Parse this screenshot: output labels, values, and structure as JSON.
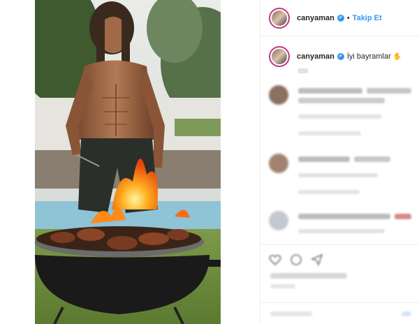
{
  "header": {
    "username": "canyaman",
    "verified_badge": "✔",
    "separator": "•",
    "follow_label": "Takip Et"
  },
  "caption": {
    "username": "canyaman",
    "verified_badge": "✔",
    "text": "İyi bayramlar",
    "emoji": "✋"
  },
  "colors": {
    "accent": "#3897f0",
    "text": "#262626",
    "border": "#efefef",
    "story_ring": "#c13584"
  }
}
